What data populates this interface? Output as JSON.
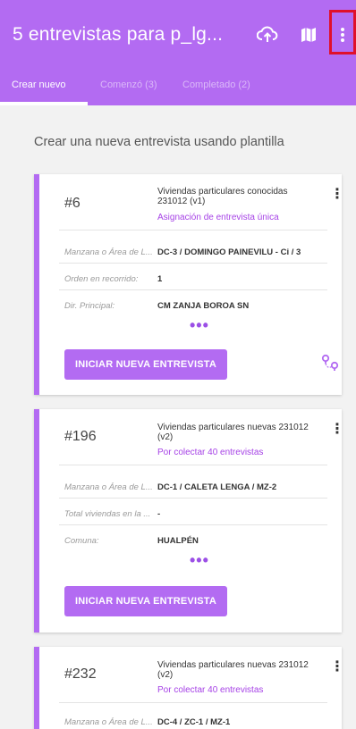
{
  "appbar": {
    "title": "5 entrevistas para p_lg...",
    "icons": [
      "cloud-sync-icon",
      "map-icon",
      "more-vert-icon"
    ]
  },
  "tabs": [
    {
      "label": "Crear nuevo",
      "active": true
    },
    {
      "label": "Comenzó (3)",
      "active": false
    },
    {
      "label": "Completado (2)",
      "active": false
    }
  ],
  "heading": "Crear una nueva entrevista usando plantilla",
  "cards": [
    {
      "number": "#6",
      "template": "Viviendas particulares conocidas 231012 (v1)",
      "status": "Asignación de entrevista única",
      "fields": [
        {
          "label": "Manzana o Área de L...",
          "value": "DC-3 / DOMINGO PAINEVILU - Ci / 3"
        },
        {
          "label": "Orden en recorrido:",
          "value": "1"
        },
        {
          "label": "Dir. Principal:",
          "value": "CM ZANJA BOROA SN"
        }
      ],
      "more": "•••",
      "button": "INICIAR NUEVA ENTREVISTA"
    },
    {
      "number": "#196",
      "template": "Viviendas particulares nuevas 231012 (v2)",
      "status": "Por colectar 40 entrevistas",
      "fields": [
        {
          "label": "Manzana o Área de L...",
          "value": "DC-1 / CALETA LENGA / MZ-2"
        },
        {
          "label": "Total viviendas en la ...",
          "value": "-"
        },
        {
          "label": "Comuna:",
          "value": "HUALPÉN"
        }
      ],
      "more": "•••",
      "button": "INICIAR NUEVA ENTREVISTA"
    },
    {
      "number": "#232",
      "template": "Viviendas particulares nuevas 231012 (v2)",
      "status": "Por colectar 40 entrevistas",
      "fields": [
        {
          "label": "Manzana o Área de L...",
          "value": "DC-4 / ZC-1 / MZ-1"
        }
      ]
    }
  ],
  "colors": {
    "primary": "#b36bf2",
    "status": "#a642e6",
    "highlight": "#e0102a"
  }
}
